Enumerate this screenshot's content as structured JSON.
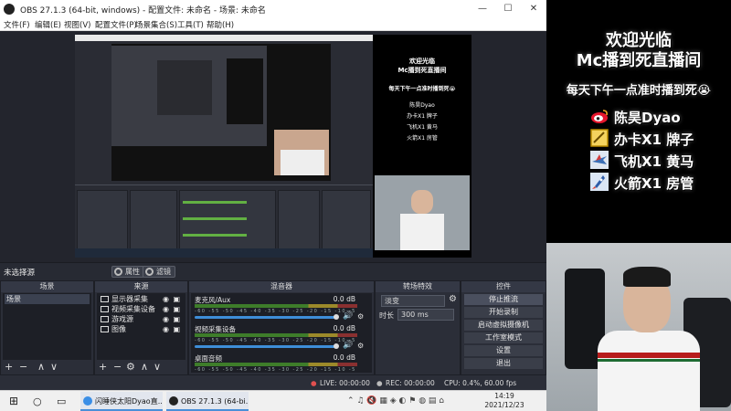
{
  "obs": {
    "title": "OBS 27.1.3 (64-bit, windows) - 配置文件: 未命名 - 场景: 未命名",
    "menu": [
      "文件(F)",
      "编辑(E)",
      "视图(V)",
      "配置文件(P)",
      "场景集合(S)",
      "工具(T)",
      "帮助(H)"
    ],
    "window_controls": [
      "—",
      "☐",
      "✕"
    ],
    "no_source_label": "未选择源",
    "properties_button": "属性",
    "filters_button": "滤镜",
    "scenes_dock": {
      "title": "场景",
      "items": [
        "场景"
      ]
    },
    "sources_dock": {
      "title": "来源",
      "items": [
        "显示器采集",
        "视频采集设备",
        "游戏源",
        "图像"
      ]
    },
    "mixer_dock": {
      "title": "混音器",
      "channels": [
        {
          "name": "麦克风/Aux",
          "db": "0.0 dB",
          "level": 0.85
        },
        {
          "name": "视频采集设备",
          "db": "0.0 dB",
          "level": 0.85
        },
        {
          "name": "桌面音频",
          "db": "0.0 dB",
          "level": 0.85
        }
      ],
      "scale": "-60 -55 -50 -45 -40 -35 -30 -25 -20 -15 -10 -5 0"
    },
    "transitions_dock": {
      "title": "转场特效",
      "type": "淡变",
      "duration_label": "时长",
      "duration_value": "300 ms"
    },
    "controls_dock": {
      "title": "控件",
      "buttons": [
        "停止推流",
        "开始录制",
        "启动虚拟摄像机",
        "工作室模式",
        "设置",
        "退出"
      ]
    },
    "status": {
      "live": "LIVE: 00:00:00",
      "rec": "REC: 00:00:00",
      "cpu": "CPU: 0.4%, 60.00 fps"
    },
    "dock_footer_icons": [
      "+",
      "−",
      "⚙",
      "∧",
      "∨"
    ]
  },
  "taskbar": {
    "apps": [
      {
        "label": "闪睡侠太阳Dyao直...",
        "color": "#3a8ee6"
      },
      {
        "label": "OBS 27.1.3 (64-bi...",
        "color": "#222222"
      }
    ],
    "time": "14:19",
    "date": "2021/12/23"
  },
  "overlay": {
    "welcome_line1": "欢迎光临",
    "welcome_line2": "Mc播到死直播间",
    "schedule": "每天下午一点准时播到死😭",
    "sponsors": [
      {
        "icon": "weibo-icon",
        "text": "陈昊Dyao"
      },
      {
        "icon": "card-icon",
        "text": "办卡X1 牌子"
      },
      {
        "icon": "plane-icon",
        "text": "飞机X1 黄马"
      },
      {
        "icon": "rocket-icon",
        "text": "火箭X1 房管"
      }
    ]
  },
  "colors": {
    "obs_bg": "#2b2e38",
    "accent_blue": "#3e8ed8",
    "meter_green": "#3e7d2a",
    "taskbar": "#f0f0f0"
  }
}
